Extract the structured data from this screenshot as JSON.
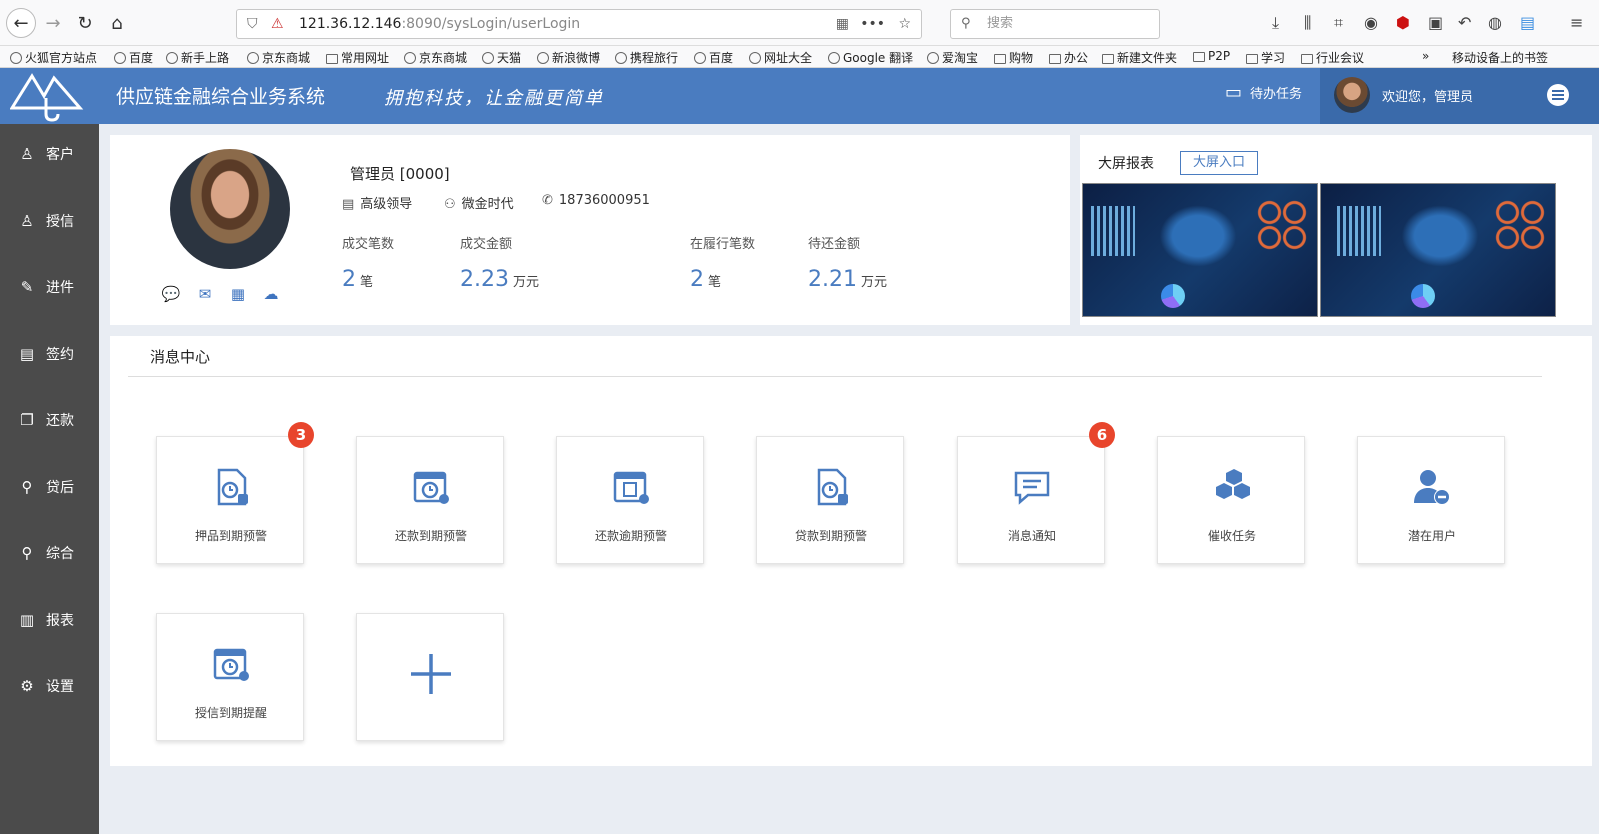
{
  "browser": {
    "url_host": "121.36.12.146",
    "url_rest": ":8090/sysLogin/userLogin",
    "search_placeholder": "搜索",
    "bookmarks": [
      "火狐官方站点",
      "百度",
      "新手上路",
      "京东商城",
      "常用网址",
      "京东商城",
      "天猫",
      "新浪微博",
      "携程旅行",
      "百度",
      "网址大全",
      "Google 翻译",
      "爱淘宝",
      "购物",
      "办公",
      "新建文件夹",
      "P2P",
      "学习",
      "行业会议"
    ],
    "mobile_bookmarks": "移动设备上的书签"
  },
  "header": {
    "title": "供应链金融综合业务系统",
    "slogan": "拥抱科技，让金融更简单",
    "todo": "待办任务",
    "welcome": "欢迎您，管理员"
  },
  "sidebar": {
    "items": [
      {
        "label": "客户",
        "icon": "user-icon"
      },
      {
        "label": "授信",
        "icon": "user-icon"
      },
      {
        "label": "进件",
        "icon": "edit-icon"
      },
      {
        "label": "签约",
        "icon": "document-icon"
      },
      {
        "label": "还款",
        "icon": "copy-icon"
      },
      {
        "label": "贷后",
        "icon": "search-icon"
      },
      {
        "label": "综合",
        "icon": "search-icon"
      },
      {
        "label": "报表",
        "icon": "bar-chart-icon"
      },
      {
        "label": "设置",
        "icon": "gear-icon"
      }
    ]
  },
  "profile": {
    "name": "管理员 [0000]",
    "role": "高级领导",
    "org": "微金时代",
    "phone": "18736000951",
    "stats": [
      {
        "label": "成交笔数",
        "value": "2",
        "unit": "笔"
      },
      {
        "label": "成交金额",
        "value": "2.23",
        "unit": "万元"
      },
      {
        "label": "在履行笔数",
        "value": "2",
        "unit": "笔"
      },
      {
        "label": "待还金额",
        "value": "2.21",
        "unit": "万元"
      }
    ]
  },
  "screen": {
    "title": "大屏报表",
    "button": "大屏入口"
  },
  "messages": {
    "title": "消息中心",
    "tiles": [
      {
        "label": "押品到期预警",
        "badge": "3",
        "icon": "doc-alarm-icon"
      },
      {
        "label": "还款到期预警",
        "badge": "",
        "icon": "calendar-alarm-icon"
      },
      {
        "label": "还款逾期预警",
        "badge": "",
        "icon": "calendar-doc-icon"
      },
      {
        "label": "贷款到期预警",
        "badge": "",
        "icon": "doc-alarm-icon"
      },
      {
        "label": "消息通知",
        "badge": "6",
        "icon": "chat-icon"
      },
      {
        "label": "催收任务",
        "badge": "",
        "icon": "boxes-icon"
      },
      {
        "label": "潜在用户",
        "badge": "",
        "icon": "user-minus-icon"
      },
      {
        "label": "授信到期提醒",
        "badge": "",
        "icon": "calendar-alarm-icon"
      },
      {
        "label": "",
        "badge": "",
        "icon": "plus-icon"
      }
    ]
  },
  "colors": {
    "primary": "#4a7cc0",
    "sidebar": "#4b4b4b",
    "badge": "#e8452c"
  }
}
